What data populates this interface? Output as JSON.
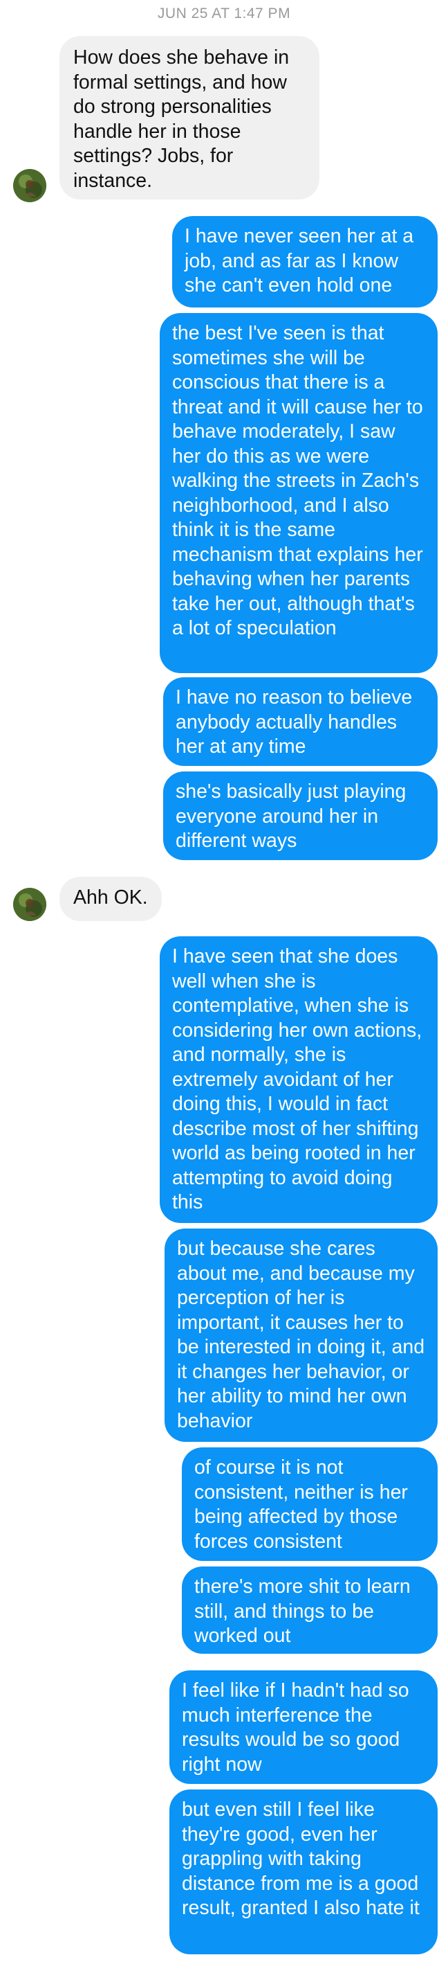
{
  "thread": {
    "timestamp": "JUN 25 AT 1:47 PM",
    "contact_avatar_icon": "contact-avatar-photo",
    "colors": {
      "incoming_bubble": "#f1f0f0",
      "outgoing_bubble": "#0b93f6",
      "timestamp_text": "#9a9a9a"
    },
    "messages": [
      {
        "from": "them",
        "text": "How does she behave in formal settings, and how do strong personalities handle her in those settings? Jobs, for instance."
      },
      {
        "from": "me",
        "text": "I have never seen her at a job, and as far as I know she can't even hold one"
      },
      {
        "from": "me",
        "text": "the best I've seen is that sometimes she will be conscious that there is a threat and it will cause her to behave moderately, I saw her do this as we were walking the streets in Zach's neighborhood, and I also think it is the same mechanism that explains her behaving when her parents take her out, although that's a lot of speculation"
      },
      {
        "from": "me",
        "text": "I have no reason to believe anybody actually handles her at any time"
      },
      {
        "from": "me",
        "text": "she's basically just playing everyone around her in different ways"
      },
      {
        "from": "them",
        "text": "Ahh OK."
      },
      {
        "from": "me",
        "text": "I have seen that she does well when she is contemplative, when she is considering her own actions, and normally, she is extremely avoidant of her doing this, I would in fact describe most of her shifting world as being rooted in her attempting to avoid doing this"
      },
      {
        "from": "me",
        "text": "but because she cares about me, and because my perception of her is important, it causes her to be interested in doing it, and it changes her behavior, or her ability to mind her own behavior"
      },
      {
        "from": "me",
        "text": "of course it is not consistent, neither is her being affected by those forces consistent"
      },
      {
        "from": "me",
        "text": "there's more shit to learn still, and things to be worked out"
      },
      {
        "from": "me",
        "text": "I feel like if I hadn't had so much interference the results would be so good right now"
      },
      {
        "from": "me",
        "text": "but even still I feel like they're good, even her grappling with taking distance from me is a good result, granted I also hate it"
      }
    ]
  }
}
